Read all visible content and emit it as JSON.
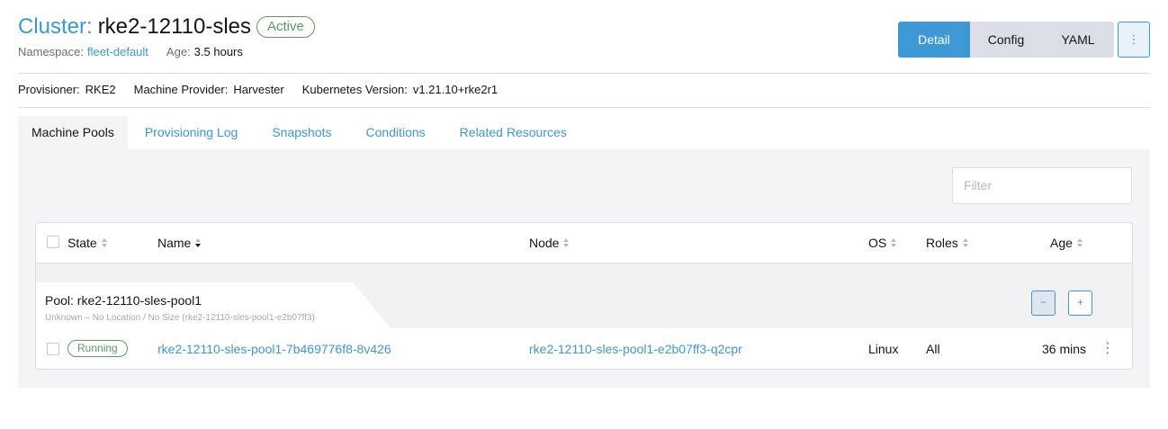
{
  "header": {
    "title_prefix": "Cluster:",
    "title_name": "rke2-12110-sles",
    "status": "Active",
    "namespace_label": "Namespace:",
    "namespace_value": "fleet-default",
    "age_label": "Age:",
    "age_value": "3.5 hours"
  },
  "view_toggle": {
    "detail": "Detail",
    "config": "Config",
    "yaml": "YAML",
    "active": "Detail"
  },
  "more_actions_icon": "⋮",
  "provisioning": {
    "provisioner_label": "Provisioner:",
    "provisioner_value": "RKE2",
    "machine_provider_label": "Machine Provider:",
    "machine_provider_value": "Harvester",
    "k8s_version_label": "Kubernetes Version:",
    "k8s_version_value": "v1.21.10+rke2r1"
  },
  "tabs": [
    {
      "label": "Machine Pools",
      "active": true
    },
    {
      "label": "Provisioning Log",
      "active": false
    },
    {
      "label": "Snapshots",
      "active": false
    },
    {
      "label": "Conditions",
      "active": false
    },
    {
      "label": "Related Resources",
      "active": false
    }
  ],
  "filter": {
    "placeholder": "Filter"
  },
  "table": {
    "columns": [
      "State",
      "Name",
      "Node",
      "OS",
      "Roles",
      "Age"
    ],
    "group": {
      "title": "Pool: rke2-12110-sles-pool1",
      "subtitle": "Unknown – No Location / No Size (rke2-12110-sles-pool1-e2b07ff3)",
      "scale_down": "−",
      "scale_up": "+"
    },
    "rows": [
      {
        "state": "Running",
        "name": "rke2-12110-sles-pool1-7b469776f8-8v426",
        "node": "rke2-12110-sles-pool1-e2b07ff3-q2cpr",
        "os": "Linux",
        "roles": "All",
        "age": "36 mins"
      }
    ]
  },
  "colors": {
    "accent": "#3d98d3",
    "success": "#5d995d",
    "panel_bg": "#f4f4f6",
    "border": "#dcdee7"
  },
  "icons": {
    "sort": "sort-icon",
    "kebab": "kebab-menu-icon",
    "checkbox": "checkbox"
  }
}
